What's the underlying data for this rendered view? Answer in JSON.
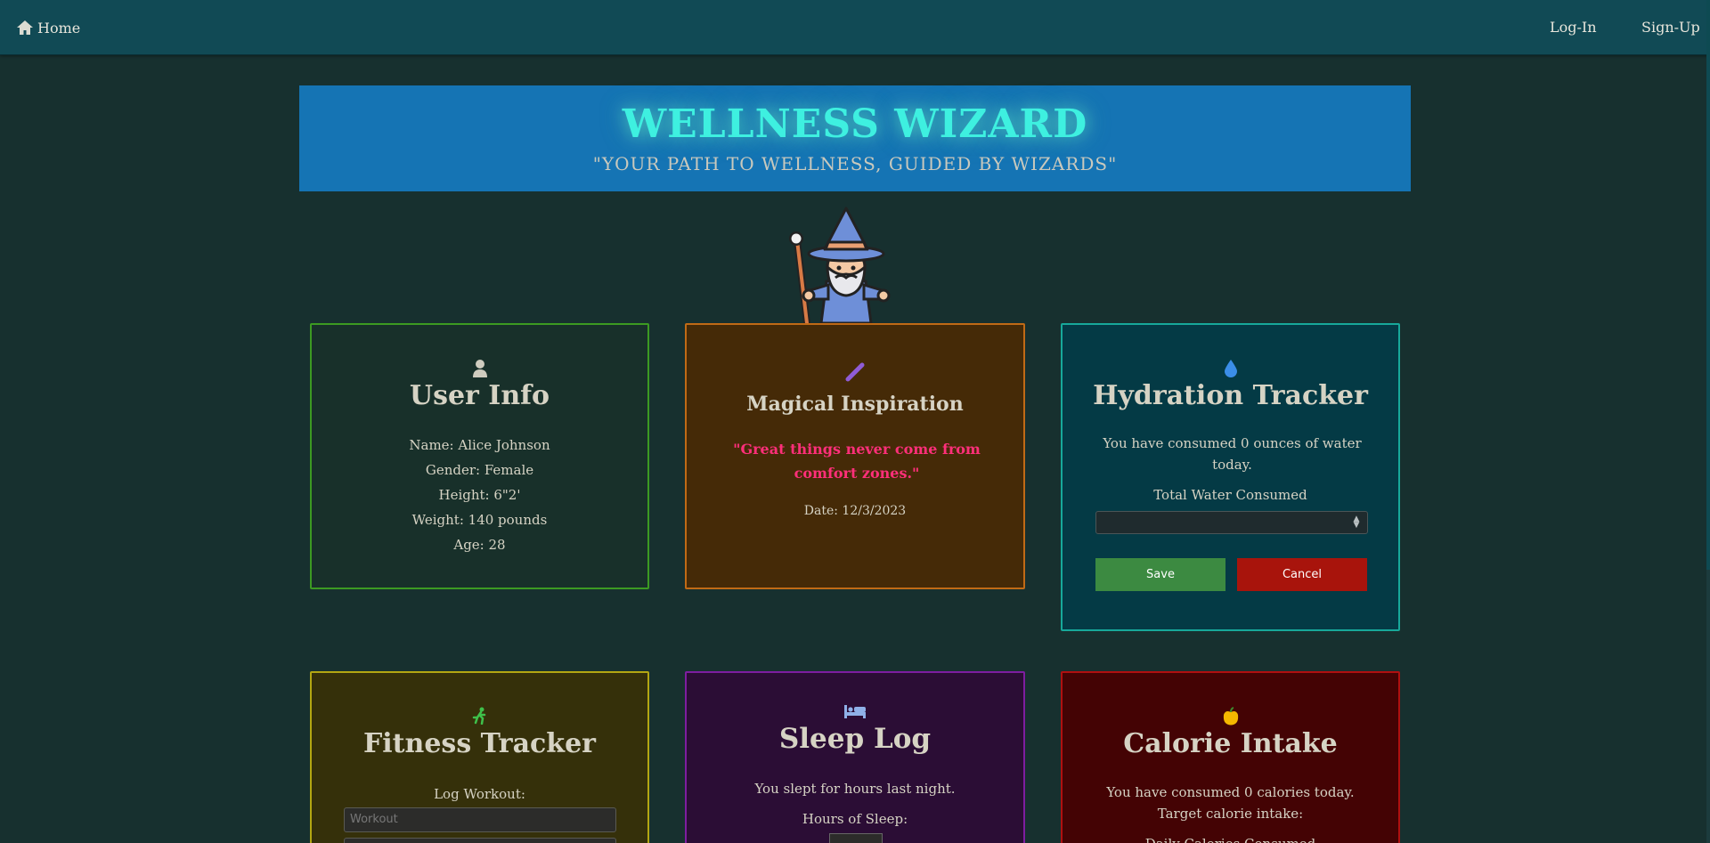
{
  "nav": {
    "home_label": "Home",
    "login_label": "Log-In",
    "signup_label": "Sign-Up"
  },
  "banner": {
    "title": "WELLNESS WIZARD",
    "tagline": "\"YOUR PATH TO WELLNESS, GUIDED BY WIZARDS\""
  },
  "user_info": {
    "title": "User Info",
    "name": "Name: Alice Johnson",
    "gender": "Gender: Female",
    "height": "Height: 6\"2'",
    "weight": "Weight: 140 pounds",
    "age": "Age: 28"
  },
  "inspiration": {
    "title": "Magical Inspiration",
    "quote": "\"Great things never come from comfort zones.\"",
    "date": "Date: 12/3/2023"
  },
  "hydration": {
    "title": "Hydration Tracker",
    "status": "You have consumed 0 ounces of water today.",
    "field_label": "Total Water Consumed",
    "field_value": "",
    "save_label": "Save",
    "cancel_label": "Cancel"
  },
  "fitness": {
    "title": "Fitness Tracker",
    "log_label": "Log Workout:",
    "workout_placeholder": "Workout"
  },
  "sleep": {
    "title": "Sleep Log",
    "status": "You slept for hours last night.",
    "hours_label": "Hours of Sleep:"
  },
  "calories": {
    "title": "Calorie Intake",
    "status": "You have consumed 0 calories today.",
    "target_label": "Target calorie intake:",
    "daily_label": "Daily Calories Consumed"
  },
  "colors": {
    "navbar": "#114a55",
    "banner": "#1574b4",
    "title_glow": "#3ef0e0",
    "save": "#3c8a41",
    "cancel": "#a8140c"
  }
}
